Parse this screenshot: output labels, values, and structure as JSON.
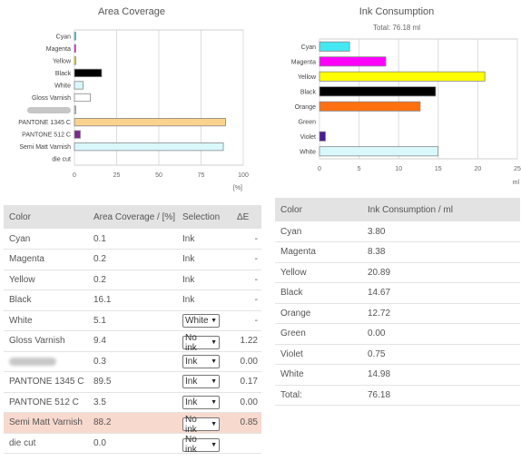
{
  "area_chart": {
    "title": "Area Coverage",
    "unit_label": "[%]"
  },
  "ink_chart": {
    "title": "Ink Consumption",
    "subtitle": "Total: 76.18 ml",
    "unit_label": "ml"
  },
  "chart_data": [
    {
      "type": "bar",
      "title": "Area Coverage",
      "xlabel": "[%]",
      "orientation": "horizontal",
      "categories": [
        "Cyan",
        "Magenta",
        "Yellow",
        "Black",
        "White",
        "Gloss Varnish",
        "",
        "PANTONE 1345 C",
        "PANTONE 512 C",
        "Semi Matt Varnish",
        "die cut"
      ],
      "values": [
        0.1,
        0.2,
        0.2,
        16.1,
        5.1,
        9.4,
        0.3,
        89.5,
        3.5,
        88.2,
        0.0
      ],
      "colors": [
        "#44e8f0",
        "#ff00ff",
        "#ffff00",
        "#000000",
        "#d8f8fc",
        "#ffffff",
        "#e0e0e0",
        "#fbd28d",
        "#7b2a8c",
        "#d8f8fc",
        "#ffffff"
      ],
      "xlim": [
        0,
        100
      ],
      "xticks": [
        0,
        25,
        50,
        75,
        100
      ],
      "grid": true
    },
    {
      "type": "bar",
      "title": "Ink Consumption",
      "subtitle": "Total: 76.18 ml",
      "xlabel": "ml",
      "orientation": "horizontal",
      "categories": [
        "Cyan",
        "Magenta",
        "Yellow",
        "Black",
        "Orange",
        "Green",
        "Violet",
        "White"
      ],
      "values": [
        3.8,
        8.38,
        20.89,
        14.67,
        12.72,
        0.0,
        0.75,
        14.98
      ],
      "colors": [
        "#44e8f0",
        "#ff00ff",
        "#ffff00",
        "#000000",
        "#ff7010",
        "#00a000",
        "#4a1a9a",
        "#d8f8fc"
      ],
      "xlim": [
        0,
        25
      ],
      "xticks": [
        0,
        5,
        10,
        15,
        20,
        25
      ],
      "grid": true
    }
  ],
  "coverage_table": {
    "headers": [
      "Color",
      "Area Coverage / [%]",
      "Selection",
      "ΔE"
    ],
    "rows": [
      {
        "color": "Cyan",
        "coverage": "0.1",
        "selection": "Ink",
        "dropdown": false,
        "de": "-",
        "highlight": false,
        "blurred": false
      },
      {
        "color": "Magenta",
        "coverage": "0.2",
        "selection": "Ink",
        "dropdown": false,
        "de": "-",
        "highlight": false,
        "blurred": false
      },
      {
        "color": "Yellow",
        "coverage": "0.2",
        "selection": "Ink",
        "dropdown": false,
        "de": "-",
        "highlight": false,
        "blurred": false
      },
      {
        "color": "Black",
        "coverage": "16.1",
        "selection": "Ink",
        "dropdown": false,
        "de": "-",
        "highlight": false,
        "blurred": false
      },
      {
        "color": "White",
        "coverage": "5.1",
        "selection": "White",
        "dropdown": true,
        "de": "-",
        "highlight": false,
        "blurred": false
      },
      {
        "color": "Gloss Varnish",
        "coverage": "9.4",
        "selection": "No ink",
        "dropdown": true,
        "de": "1.22",
        "highlight": false,
        "blurred": false
      },
      {
        "color": "",
        "coverage": "0.3",
        "selection": "Ink",
        "dropdown": true,
        "de": "0.00",
        "highlight": false,
        "blurred": true
      },
      {
        "color": "PANTONE 1345 C",
        "coverage": "89.5",
        "selection": "Ink",
        "dropdown": true,
        "de": "0.17",
        "highlight": false,
        "blurred": false
      },
      {
        "color": "PANTONE 512 C",
        "coverage": "3.5",
        "selection": "Ink",
        "dropdown": true,
        "de": "0.00",
        "highlight": false,
        "blurred": false
      },
      {
        "color": "Semi Matt Varnish",
        "coverage": "88.2",
        "selection": "No ink",
        "dropdown": true,
        "de": "0.85",
        "highlight": true,
        "blurred": false
      },
      {
        "color": "die cut",
        "coverage": "0.0",
        "selection": "No ink",
        "dropdown": true,
        "de": "",
        "highlight": false,
        "blurred": false
      }
    ]
  },
  "ink_table": {
    "headers": [
      "Color",
      "Ink Consumption / ml"
    ],
    "rows": [
      {
        "color": "Cyan",
        "value": "3.80"
      },
      {
        "color": "Magenta",
        "value": "8.38"
      },
      {
        "color": "Yellow",
        "value": "20.89"
      },
      {
        "color": "Black",
        "value": "14.67"
      },
      {
        "color": "Orange",
        "value": "12.72"
      },
      {
        "color": "Green",
        "value": "0.00"
      },
      {
        "color": "Violet",
        "value": "0.75"
      },
      {
        "color": "White",
        "value": "14.98"
      },
      {
        "color": "Total:",
        "value": "76.18"
      }
    ]
  }
}
